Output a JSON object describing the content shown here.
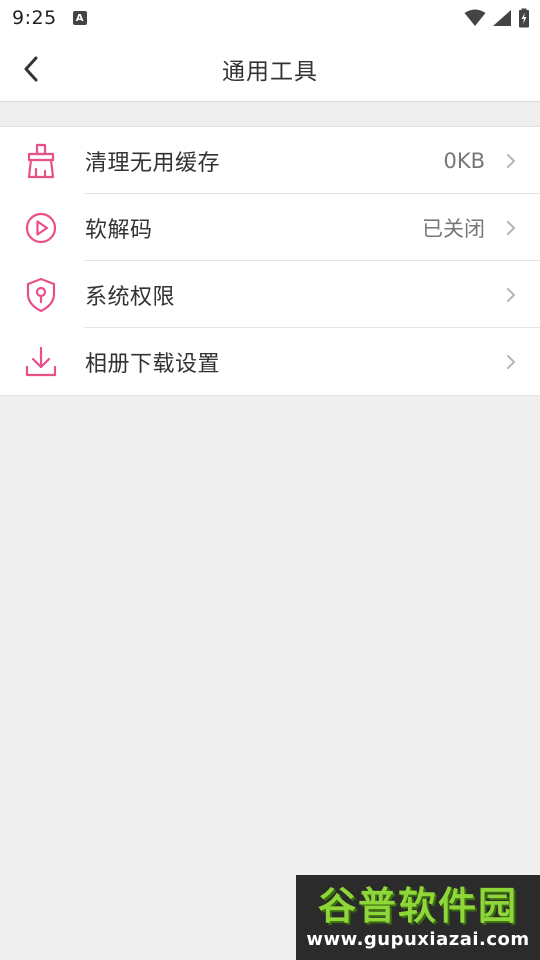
{
  "status_bar": {
    "time": "9:25",
    "notification_letter": "A"
  },
  "header": {
    "title": "通用工具"
  },
  "menu": {
    "items": [
      {
        "label": "清理无用缓存",
        "value": "0KB",
        "icon": "broom-icon"
      },
      {
        "label": "软解码",
        "value": "已关闭",
        "icon": "play-circle-icon"
      },
      {
        "label": "系统权限",
        "value": "",
        "icon": "shield-lock-icon"
      },
      {
        "label": "相册下载设置",
        "value": "",
        "icon": "download-icon"
      }
    ]
  },
  "watermark": {
    "title": "谷普软件园",
    "url": "www.gupuxiazai.com"
  },
  "colors": {
    "accent": "#e8508a",
    "background": "#efefef",
    "chevron": "#b5b5b5"
  }
}
